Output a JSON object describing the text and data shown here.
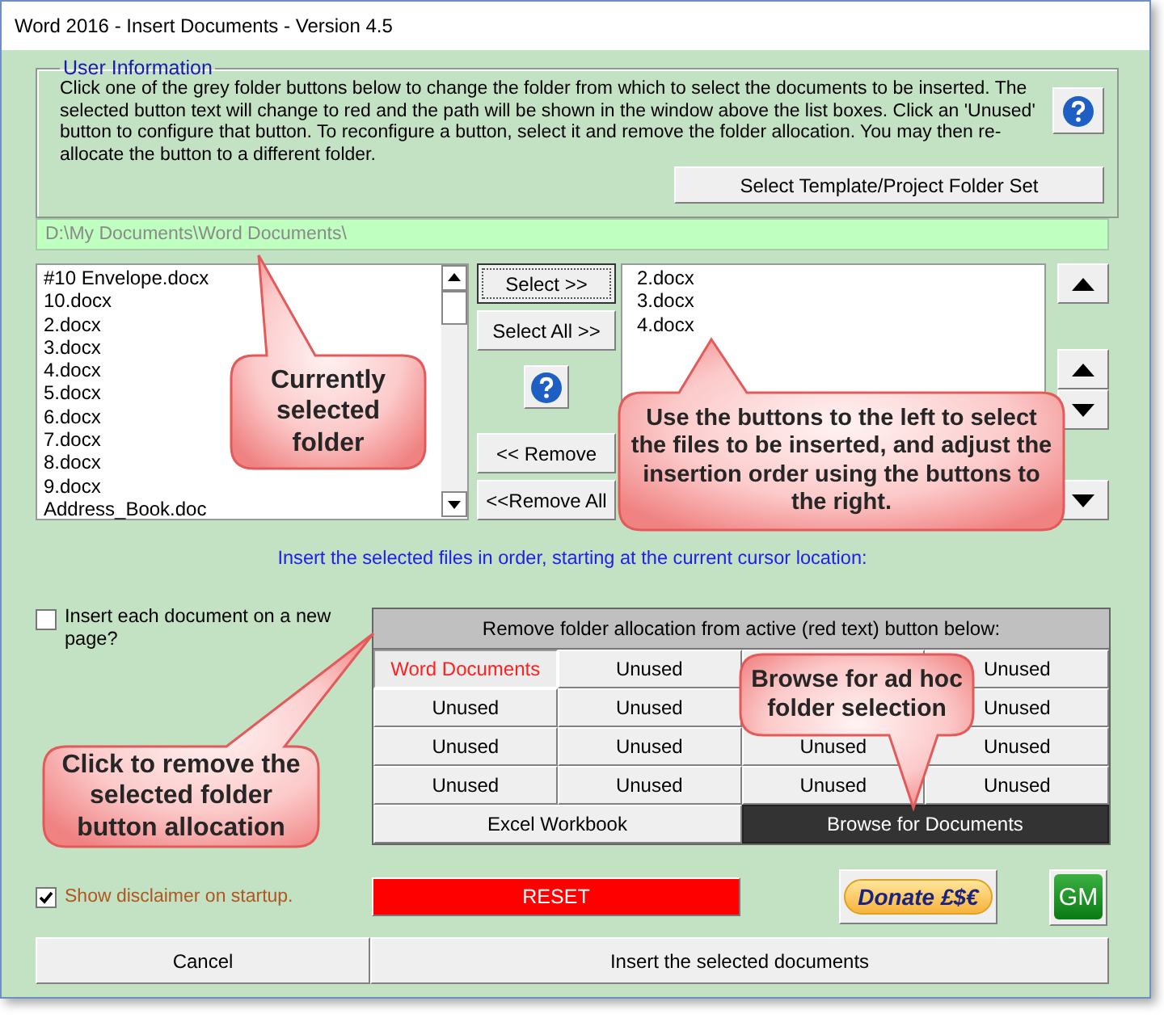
{
  "window": {
    "title": "Word 2016 - Insert Documents - Version 4.5"
  },
  "user_information": {
    "legend": "User Information",
    "text": "Click one of the grey folder buttons below to change the folder from which to select the documents to be inserted. The selected button text will change to red and the path will be shown in the window above the list boxes. Click an 'Unused' button to configure that button. To reconfigure a button, select it and remove the folder allocation. You may then re-allocate the button to a different folder.",
    "template_button": "Select Template/Project Folder Set"
  },
  "folder_path": {
    "value": "D:\\My Documents\\Word Documents\\"
  },
  "source_files": [
    "#10 Envelope.docx",
    "10.docx",
    "2.docx",
    "3.docx",
    "4.docx",
    "5.docx",
    "6.docx",
    "7.docx",
    "8.docx",
    "9.docx",
    "Address_Book.doc"
  ],
  "transfer_buttons": [
    "Select >>",
    "Select All >>",
    "<< Remove",
    "<<Remove All"
  ],
  "selected_files": [
    "2.docx",
    "3.docx",
    "4.docx"
  ],
  "instruction": "Insert the selected files in order, starting at the current cursor location:",
  "new_page_option": {
    "label": "Insert each document on a new page?",
    "checked": false
  },
  "folder_grid": {
    "header": "Remove folder allocation from active (red text) button below:",
    "buttons": [
      {
        "label": "Word Documents",
        "active": true
      },
      {
        "label": "Unused",
        "active": false
      },
      {
        "label": "Unused",
        "active": false
      },
      {
        "label": "Unused",
        "active": false
      },
      {
        "label": "Unused",
        "active": false
      },
      {
        "label": "Unused",
        "active": false
      },
      {
        "label": "Unused",
        "active": false
      },
      {
        "label": "Unused",
        "active": false
      },
      {
        "label": "Unused",
        "active": false
      },
      {
        "label": "Unused",
        "active": false
      },
      {
        "label": "Unused",
        "active": false
      },
      {
        "label": "Unused",
        "active": false
      },
      {
        "label": "Unused",
        "active": false
      },
      {
        "label": "Unused",
        "active": false
      }
    ],
    "bottom_buttons": [
      {
        "label": "Excel Workbook",
        "highlighted": false
      },
      {
        "label": "Browse for Documents",
        "highlighted": true
      }
    ]
  },
  "disclaimer_option": {
    "label": "Show disclaimer on startup.",
    "checked": true
  },
  "reset_button": "RESET",
  "donate_button": "Donate £$€",
  "gm_button": "GM",
  "actions": [
    "Cancel",
    "Insert the selected documents"
  ],
  "callouts": [
    "Currently selected folder",
    "Use the buttons to the left to select the files to be inserted, and adjust the insertion order using the buttons to the right.",
    "Click to remove the selected folder button allocation",
    "Browse for ad hoc folder selection"
  ]
}
